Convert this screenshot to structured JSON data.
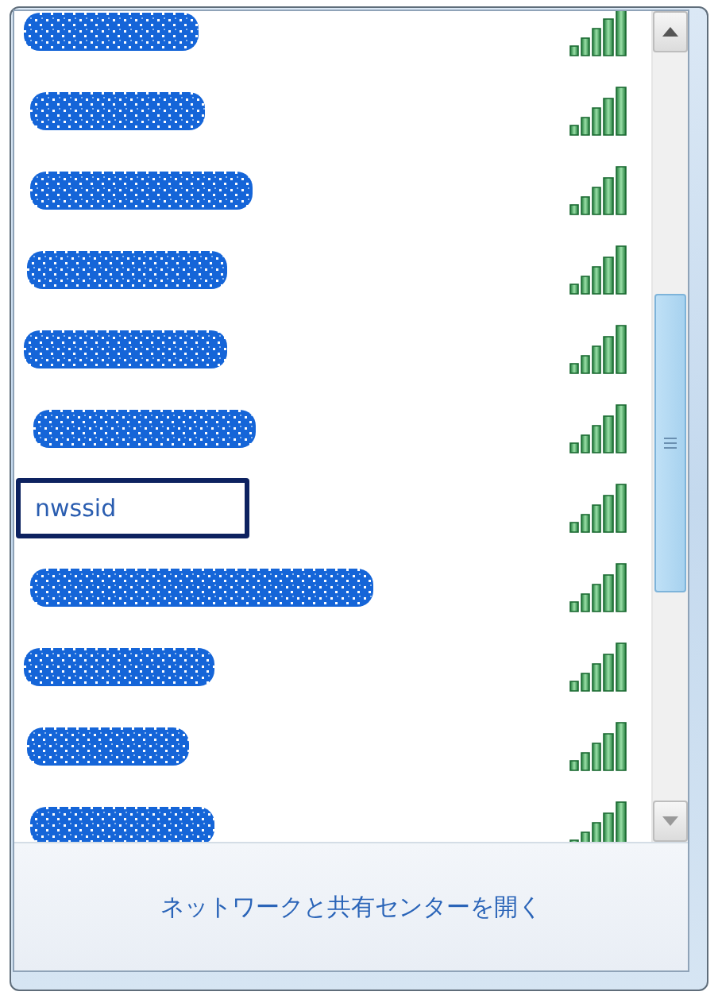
{
  "networks": [
    {
      "kind": "redacted",
      "selected": false
    },
    {
      "kind": "redacted",
      "selected": false
    },
    {
      "kind": "redacted",
      "selected": false
    },
    {
      "kind": "redacted",
      "selected": false
    },
    {
      "kind": "redacted",
      "selected": false
    },
    {
      "kind": "redacted",
      "selected": false
    },
    {
      "kind": "named",
      "name": "nwssid",
      "selected": true
    },
    {
      "kind": "redacted",
      "selected": false
    },
    {
      "kind": "redacted",
      "selected": false
    },
    {
      "kind": "redacted",
      "selected": false
    },
    {
      "kind": "redacted",
      "selected": false
    }
  ],
  "footer": {
    "link": "ネットワークと共有センターを開く"
  }
}
